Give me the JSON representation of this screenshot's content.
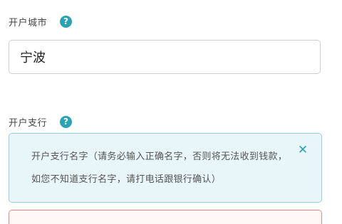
{
  "account_city": {
    "label": "开户城市",
    "help_icon": "question-circle-icon",
    "value": "宁波"
  },
  "account_branch": {
    "label": "开户支行",
    "help_icon": "question-circle-icon",
    "tip": {
      "text": "开户支行名字（请务必输入正确名字，否则将无法收到钱款，如您不知道支行名字，请打电话跟银行确认）",
      "close_icon": "close-icon"
    }
  },
  "colors": {
    "accent": "#2aa3b5",
    "tip_background": "#e9f6f9",
    "tip_border": "#96d3de",
    "error_border": "#e08a7a"
  }
}
